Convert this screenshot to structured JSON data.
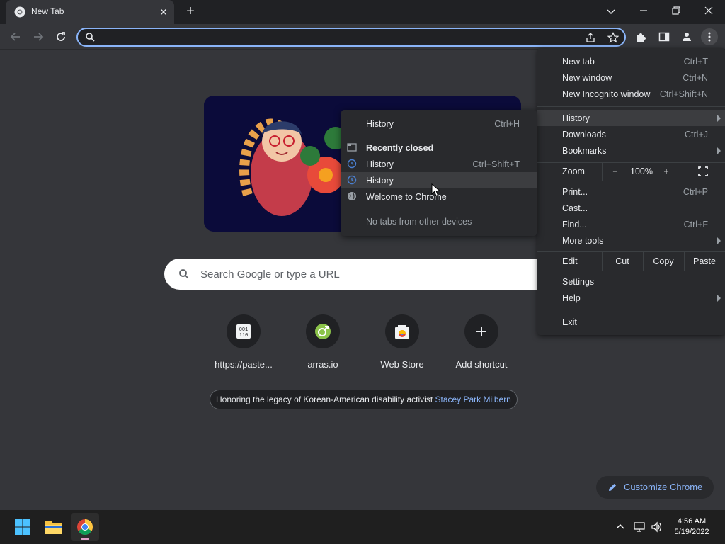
{
  "browser": {
    "tab_title": "New Tab",
    "omnibox_value": ""
  },
  "ntp": {
    "search_placeholder": "Search Google or type a URL",
    "shortcuts": [
      {
        "label": "https://paste...",
        "icon": "binary-icon"
      },
      {
        "label": "arras.io",
        "icon": "arras-icon"
      },
      {
        "label": "Web Store",
        "icon": "web-store-icon"
      },
      {
        "label": "Add shortcut",
        "icon": "plus-icon"
      }
    ],
    "caption_text": "Honoring the legacy of Korean-American disability activist ",
    "caption_link": "Stacey Park Milbern",
    "customize_label": "Customize Chrome"
  },
  "menu": {
    "new_tab": {
      "label": "New tab",
      "shortcut": "Ctrl+T"
    },
    "new_window": {
      "label": "New window",
      "shortcut": "Ctrl+N"
    },
    "incognito": {
      "label": "New Incognito window",
      "shortcut": "Ctrl+Shift+N"
    },
    "history": {
      "label": "History"
    },
    "downloads": {
      "label": "Downloads",
      "shortcut": "Ctrl+J"
    },
    "bookmarks": {
      "label": "Bookmarks"
    },
    "zoom": {
      "label": "Zoom",
      "minus": "−",
      "value": "100%",
      "plus": "+"
    },
    "print": {
      "label": "Print...",
      "shortcut": "Ctrl+P"
    },
    "cast": {
      "label": "Cast..."
    },
    "find": {
      "label": "Find...",
      "shortcut": "Ctrl+F"
    },
    "more_tools": {
      "label": "More tools"
    },
    "edit": {
      "label": "Edit",
      "cut": "Cut",
      "copy": "Copy",
      "paste": "Paste"
    },
    "settings": {
      "label": "Settings"
    },
    "help": {
      "label": "Help"
    },
    "exit": {
      "label": "Exit"
    }
  },
  "history_submenu": {
    "history": {
      "label": "History",
      "shortcut": "Ctrl+H"
    },
    "recently_closed": "Recently closed",
    "items": [
      {
        "label": "History",
        "shortcut": "Ctrl+Shift+T"
      },
      {
        "label": "History",
        "shortcut": ""
      },
      {
        "label": "Welcome to Chrome",
        "shortcut": ""
      }
    ],
    "no_tabs": "No tabs from other devices"
  },
  "taskbar": {
    "time": "4:56 AM",
    "date": "5/19/2022"
  },
  "colors": {
    "accent": "#8ab4f8",
    "background": "#35363a",
    "menu_bg": "#292a2d"
  }
}
